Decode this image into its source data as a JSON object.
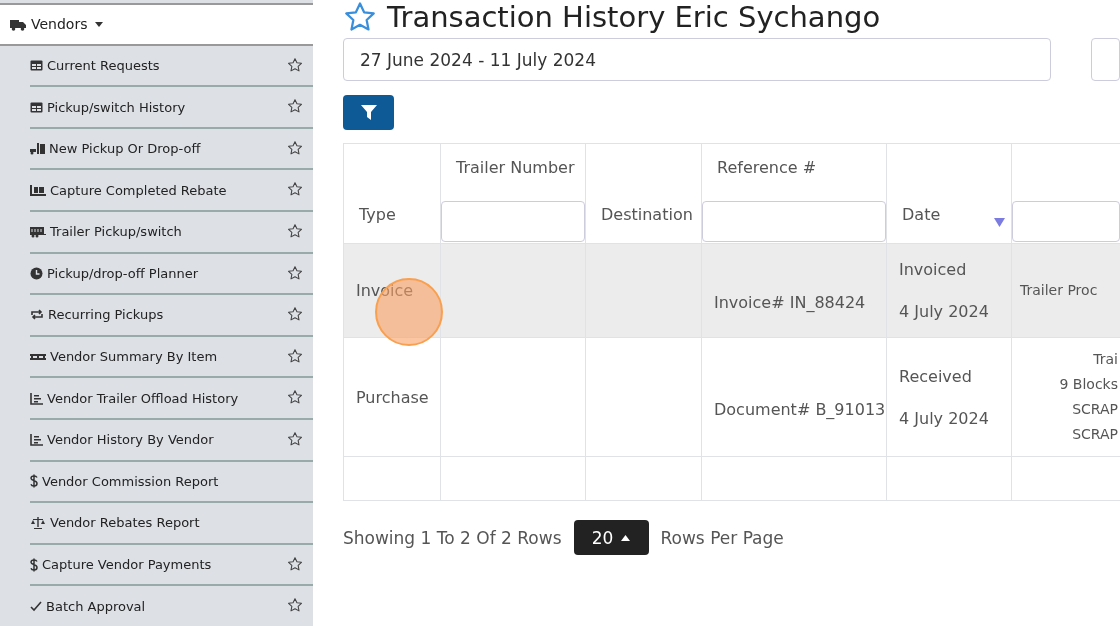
{
  "sidebar": {
    "header": {
      "label": "Vendors",
      "kind": "truck",
      "expanded": true
    },
    "items": [
      {
        "label": "Current Requests",
        "kind": "table",
        "star": true
      },
      {
        "label": "Pickup/switch History",
        "kind": "table",
        "star": true
      },
      {
        "label": "New Pickup Or Drop-off",
        "kind": "loading",
        "star": true
      },
      {
        "label": "Capture Completed Rebate",
        "kind": "dolly",
        "star": true
      },
      {
        "label": "Trailer Pickup/switch",
        "kind": "trailer",
        "star": true
      },
      {
        "label": "Pickup/drop-off Planner",
        "kind": "clock",
        "star": true
      },
      {
        "label": "Recurring Pickups",
        "kind": "repeat",
        "star": true
      },
      {
        "label": "Vendor Summary By Item",
        "kind": "pallet",
        "star": true
      },
      {
        "label": "Vendor Trailer Offload History",
        "kind": "chart",
        "star": true
      },
      {
        "label": "Vendor History By Vendor",
        "kind": "chart",
        "star": true
      },
      {
        "label": "Vendor Commission Report",
        "kind": "dollar",
        "star": false
      },
      {
        "label": "Vendor Rebates Report",
        "kind": "scale",
        "star": false
      },
      {
        "label": "Capture Vendor Payments",
        "kind": "dollar",
        "star": true
      },
      {
        "label": "Batch Approval",
        "kind": "check",
        "star": true
      }
    ]
  },
  "page": {
    "title": "Transaction History Eric Sychango",
    "date_range": "27 June 2024 - 11 July 2024"
  },
  "table": {
    "columns": [
      {
        "label": "Type",
        "filter": false,
        "sorted": false
      },
      {
        "label": "Trailer Number",
        "filter": true,
        "sorted": false
      },
      {
        "label": "Destination",
        "filter": false,
        "sorted": false
      },
      {
        "label": "Reference #",
        "filter": true,
        "sorted": false
      },
      {
        "label": "Date",
        "filter": false,
        "sorted": true
      },
      {
        "filter": true,
        "sorted": false
      }
    ],
    "rows": [
      {
        "selected": true,
        "cells": [
          [
            "Invoice"
          ],
          [],
          [],
          [
            "Invoice# IN_88424"
          ],
          [
            "Invoiced",
            "4 July 2024"
          ],
          [
            "Trailer Proc"
          ]
        ]
      },
      {
        "selected": false,
        "cells": [
          [
            "Purchase"
          ],
          [],
          [],
          [
            "Document# B_91013"
          ],
          [
            "Received",
            "4 July 2024"
          ],
          [
            "Trai",
            "9 Blocks",
            "SCRAP",
            "SCRAP"
          ]
        ]
      }
    ]
  },
  "pagination": {
    "summary": "Showing 1 To 2 Of 2 Rows",
    "page_size": "20",
    "suffix": "Rows Per Page"
  }
}
